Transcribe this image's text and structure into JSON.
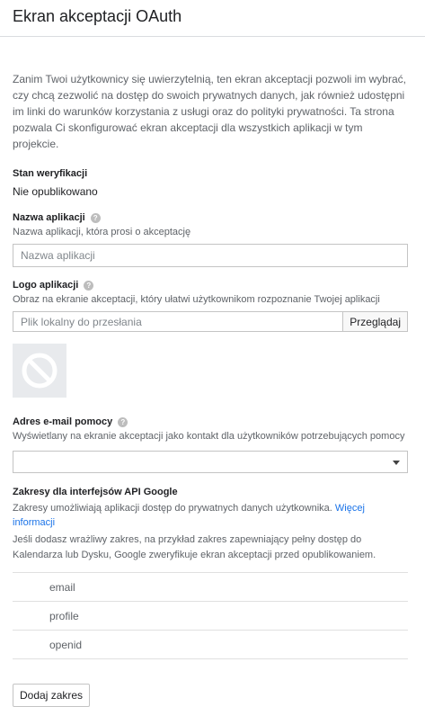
{
  "header": {
    "title": "Ekran akceptacji OAuth"
  },
  "intro": "Zanim Twoi użytkownicy się uwierzytelnią, ten ekran akceptacji pozwoli im wybrać, czy chcą zezwolić na dostęp do swoich prywatnych danych, jak również udostępni im linki do warunków korzystania z usługi oraz do polityki prywatności. Ta strona pozwala Ci skonfigurować ekran akceptacji dla wszystkich aplikacji w tym projekcie.",
  "verification": {
    "label": "Stan weryfikacji",
    "value": "Nie opublikowano"
  },
  "app_name": {
    "label": "Nazwa aplikacji",
    "description": "Nazwa aplikacji, która prosi o akceptację",
    "placeholder": "Nazwa aplikacji",
    "help_icon": "question-mark"
  },
  "app_logo": {
    "label": "Logo aplikacji",
    "description": "Obraz na ekranie akceptacji, który ułatwi użytkownikom rozpoznanie Twojej aplikacji",
    "file_placeholder": "Plik lokalny do przesłania",
    "browse_label": "Przeglądaj",
    "help_icon": "question-mark",
    "preview_icon": "no-image-icon"
  },
  "support_email": {
    "label": "Adres e-mail pomocy",
    "description": "Wyświetlany na ekranie akceptacji jako kontakt dla użytkowników potrzebujących pomocy",
    "selected_value": "",
    "help_icon": "question-mark"
  },
  "scopes": {
    "label": "Zakresy dla interfejsów API Google",
    "description": "Zakresy umożliwiają aplikacji dostęp do prywatnych danych użytkownika.",
    "link_text": "Więcej informacji",
    "warning": "Jeśli dodasz wrażliwy zakres, na przykład zakres zapewniający pełny dostęp do Kalendarza lub Dysku, Google zweryfikuje ekran akceptacji przed opublikowaniem.",
    "items": [
      "email",
      "profile",
      "openid"
    ],
    "add_button_label": "Dodaj zakres"
  },
  "colors": {
    "link": "#1a73e8",
    "border": "#c4c4c4",
    "muted_text": "#5f6368"
  }
}
